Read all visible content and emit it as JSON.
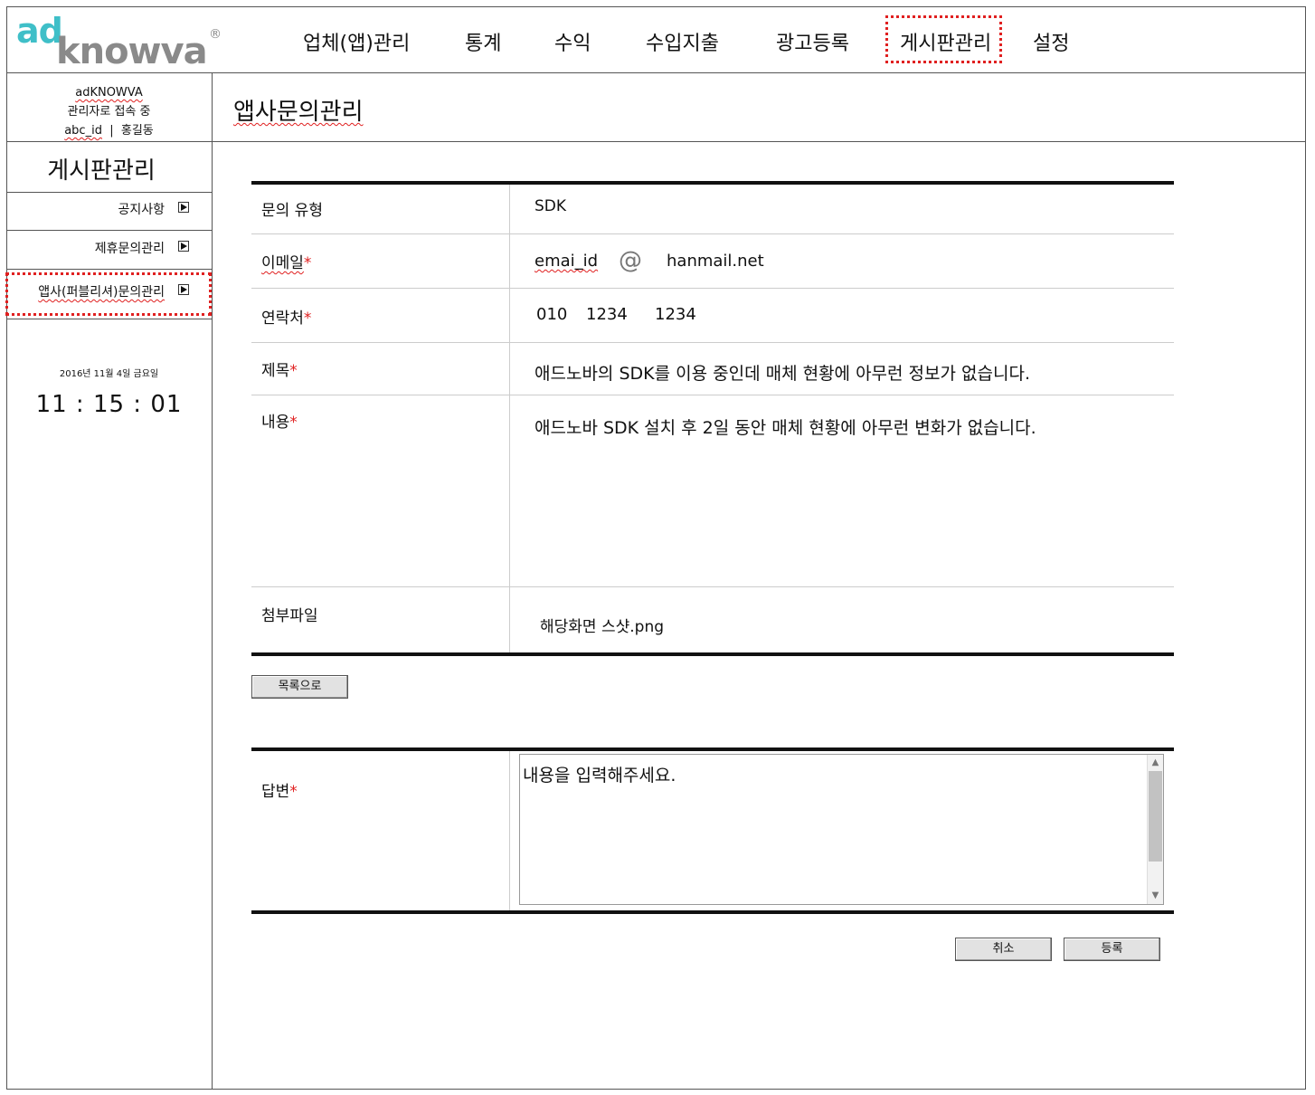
{
  "brand": {
    "logo_ad": "ad",
    "logo_knowva": "knowva",
    "logo_reg": "®"
  },
  "nav": {
    "items": [
      "업체(앱)관리",
      "통계",
      "수익",
      "수입지출",
      "광고등록",
      "게시판관리",
      "설정"
    ],
    "active_index": 5
  },
  "admin": {
    "line1": "adKNOWVA",
    "line2": "관리자로 접속 중",
    "user_id": "abc_id",
    "separator": "|",
    "user_name": "홍길동"
  },
  "sidebar": {
    "title": "게시판관리",
    "items": [
      {
        "label": "공지사항"
      },
      {
        "label": "제휴문의관리"
      },
      {
        "label": "앱사(퍼블리셔)문의관리"
      }
    ],
    "active_index": 2,
    "date": "2016년 11월 4일 금요일",
    "time": "11 : 15 : 01"
  },
  "page": {
    "title": "앱사문의관리"
  },
  "form": {
    "required_mark": "*",
    "type_label": "문의 유형",
    "type_value": "SDK",
    "email_label": "이메일",
    "email_id": "emai_id",
    "email_at": "@",
    "email_domain": "hanmail.net",
    "phone_label": "연락처",
    "phone_1": "010",
    "phone_2": "1234",
    "phone_3": "1234",
    "subject_label": "제목",
    "subject_value": "애드노바의 SDK를 이용 중인데 매체 현황에 아무런 정보가 없습니다.",
    "content_label": "내용",
    "content_value": "애드노바 SDK 설치 후 2일 동안 매체 현황에 아무런 변화가 없습니다.",
    "attach_label": "첨부파일",
    "attach_value": "해당화면 스샷.png"
  },
  "buttons": {
    "list": "목록으로",
    "cancel": "취소",
    "submit": "등록"
  },
  "reply": {
    "label": "답변",
    "placeholder": "내용을 입력해주세요."
  },
  "colors": {
    "accent_teal": "#3fbfc8",
    "logo_gray": "#8a8a8a",
    "highlight_red": "#e02020"
  }
}
